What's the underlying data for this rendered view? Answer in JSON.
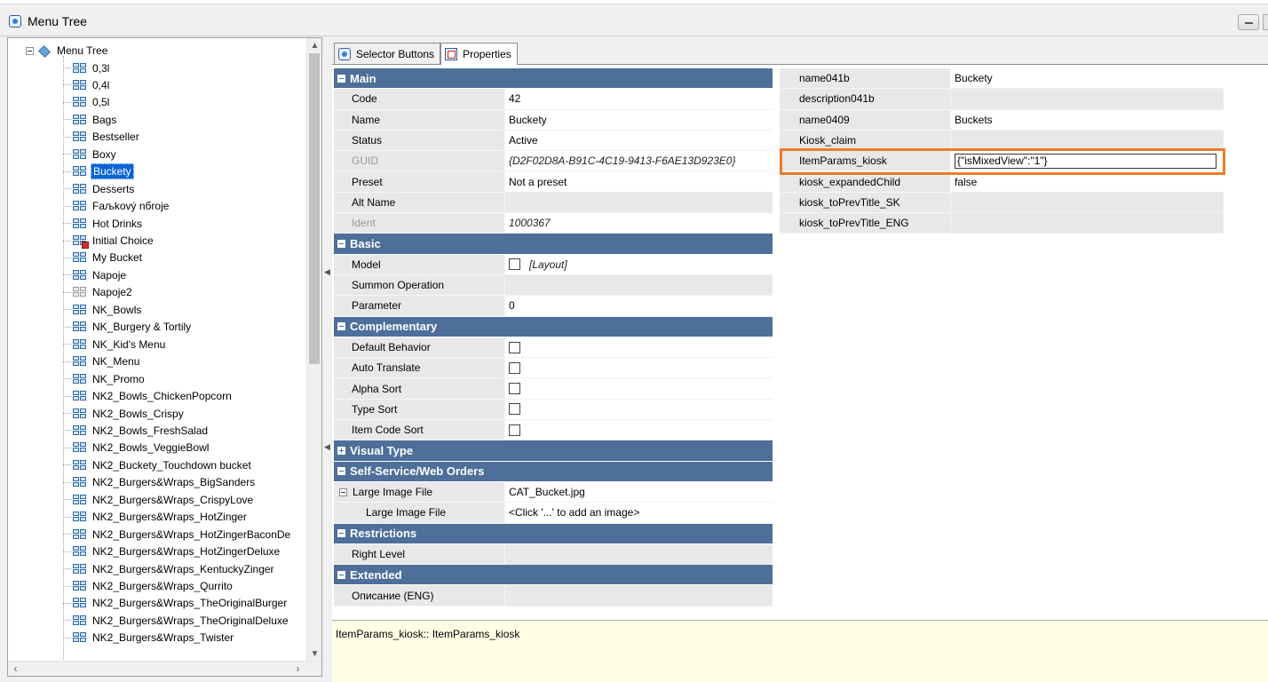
{
  "window": {
    "title": "Menu Tree"
  },
  "tree": {
    "root": "Menu Tree",
    "items": [
      {
        "label": "0,3l",
        "icon": "grid"
      },
      {
        "label": "0,4l",
        "icon": "grid"
      },
      {
        "label": "0,5l",
        "icon": "grid"
      },
      {
        "label": "Bags",
        "icon": "grid"
      },
      {
        "label": "Bestseller",
        "icon": "grid"
      },
      {
        "label": "Boxy",
        "icon": "grid"
      },
      {
        "label": "Buckety",
        "icon": "grid",
        "selected": true
      },
      {
        "label": "Desserts",
        "icon": "grid"
      },
      {
        "label": "Fаљkový nбroje",
        "icon": "grid"
      },
      {
        "label": "Hot Drinks",
        "icon": "grid"
      },
      {
        "label": "Initial Choice",
        "icon": "grid-red"
      },
      {
        "label": "My Bucket",
        "icon": "grid"
      },
      {
        "label": "Napoje",
        "icon": "grid"
      },
      {
        "label": "Napoje2",
        "icon": "grid-grey"
      },
      {
        "label": "NK_Bowls",
        "icon": "grid"
      },
      {
        "label": "NK_Burgery & Tortily",
        "icon": "grid"
      },
      {
        "label": "NK_Kid's Menu",
        "icon": "grid"
      },
      {
        "label": "NK_Menu",
        "icon": "grid"
      },
      {
        "label": "NK_Promo",
        "icon": "grid"
      },
      {
        "label": "NK2_Bowls_ChickenPopcorn",
        "icon": "grid"
      },
      {
        "label": "NK2_Bowls_Crispy",
        "icon": "grid"
      },
      {
        "label": "NK2_Bowls_FreshSalad",
        "icon": "grid"
      },
      {
        "label": "NK2_Bowls_VeggieBowl",
        "icon": "grid"
      },
      {
        "label": "NK2_Buckety_Touchdown bucket",
        "icon": "grid"
      },
      {
        "label": "NK2_Burgers&Wraps_BigSanders",
        "icon": "grid"
      },
      {
        "label": "NK2_Burgers&Wraps_CrispyLove",
        "icon": "grid"
      },
      {
        "label": "NK2_Burgers&Wraps_HotZinger",
        "icon": "grid"
      },
      {
        "label": "NK2_Burgers&Wraps_HotZingerBaconDe",
        "icon": "grid"
      },
      {
        "label": "NK2_Burgers&Wraps_HotZingerDeluxe",
        "icon": "grid"
      },
      {
        "label": "NK2_Burgers&Wraps_KentuckyZinger",
        "icon": "grid"
      },
      {
        "label": "NK2_Burgers&Wraps_Qurrito",
        "icon": "grid"
      },
      {
        "label": "NK2_Burgers&Wraps_TheOriginalBurger",
        "icon": "grid"
      },
      {
        "label": "NK2_Burgers&Wraps_TheOriginalDeluxe",
        "icon": "grid"
      },
      {
        "label": "NK2_Burgers&Wraps_Twister",
        "icon": "grid"
      }
    ]
  },
  "tabs": [
    {
      "label": "Selector Buttons",
      "icon": "selector-icon"
    },
    {
      "label": "Properties",
      "icon": "properties-icon",
      "active": true
    }
  ],
  "properties": [
    {
      "category": "Main"
    },
    {
      "name": "Code",
      "value": "42"
    },
    {
      "name": "Name",
      "value": "Buckety"
    },
    {
      "name": "Status",
      "value": "Active"
    },
    {
      "name": "GUID",
      "value": "{D2F02D8A-B91C-4C19-9413-F6AE13D923E0}",
      "dim": true,
      "italic": true
    },
    {
      "name": "Preset",
      "value": "Not a preset"
    },
    {
      "name": "Alt Name",
      "value": "",
      "blank": true
    },
    {
      "name": "Ident",
      "value": "1000367",
      "dim": true,
      "italic": true
    },
    {
      "category": "Basic"
    },
    {
      "name": "Model",
      "value": "[Layout]",
      "checkbox": true,
      "italic": true
    },
    {
      "name": "Summon Operation",
      "value": "",
      "blank": true
    },
    {
      "name": "Parameter",
      "value": "0"
    },
    {
      "category": "Complementary"
    },
    {
      "name": "Default Behavior",
      "value": "",
      "checkbox": true
    },
    {
      "name": "Auto Translate",
      "value": "",
      "checkbox": true
    },
    {
      "name": "Alpha Sort",
      "value": "",
      "checkbox": true
    },
    {
      "name": "Type Sort",
      "value": "",
      "checkbox": true
    },
    {
      "name": "Item Code Sort",
      "value": "",
      "checkbox": true
    },
    {
      "category": "Visual Type",
      "collapsed": true
    },
    {
      "category": "Self-Service/Web Orders"
    },
    {
      "name": "Large Image File",
      "value": "CAT_Bucket.jpg",
      "expand": true
    },
    {
      "name": "Large Image File",
      "value": "<Click '...' to add an image>",
      "sub": true
    },
    {
      "category": "Restrictions"
    },
    {
      "name": "Right Level",
      "value": "",
      "blank": true
    },
    {
      "category": "Extended"
    },
    {
      "name": "Описание (ENG)",
      "value": "",
      "blank": true
    }
  ],
  "extended": [
    {
      "name": "name041b",
      "value": "Buckety"
    },
    {
      "name": "description041b",
      "value": "",
      "blank": true
    },
    {
      "name": "name0409",
      "value": "Buckets"
    },
    {
      "name": "Kiosk_claim",
      "value": "",
      "blank": true
    },
    {
      "name": "ItemParams_kiosk",
      "value": "{\"isMixedView\":\"1\"}",
      "editing": true
    },
    {
      "name": "kiosk_expandedChild",
      "value": "false"
    },
    {
      "name": "kiosk_toPrevTitle_SK",
      "value": "",
      "blank": true
    },
    {
      "name": "kiosk_toPrevTitle_ENG",
      "value": "",
      "blank": true
    }
  ],
  "description": "ItemParams_kiosk:: ItemParams_kiosk",
  "colors": {
    "category_bg": "#4d6f99",
    "highlight": "#f07a2a",
    "selection": "#0a64d8",
    "desc_bg": "#ffffe6"
  }
}
